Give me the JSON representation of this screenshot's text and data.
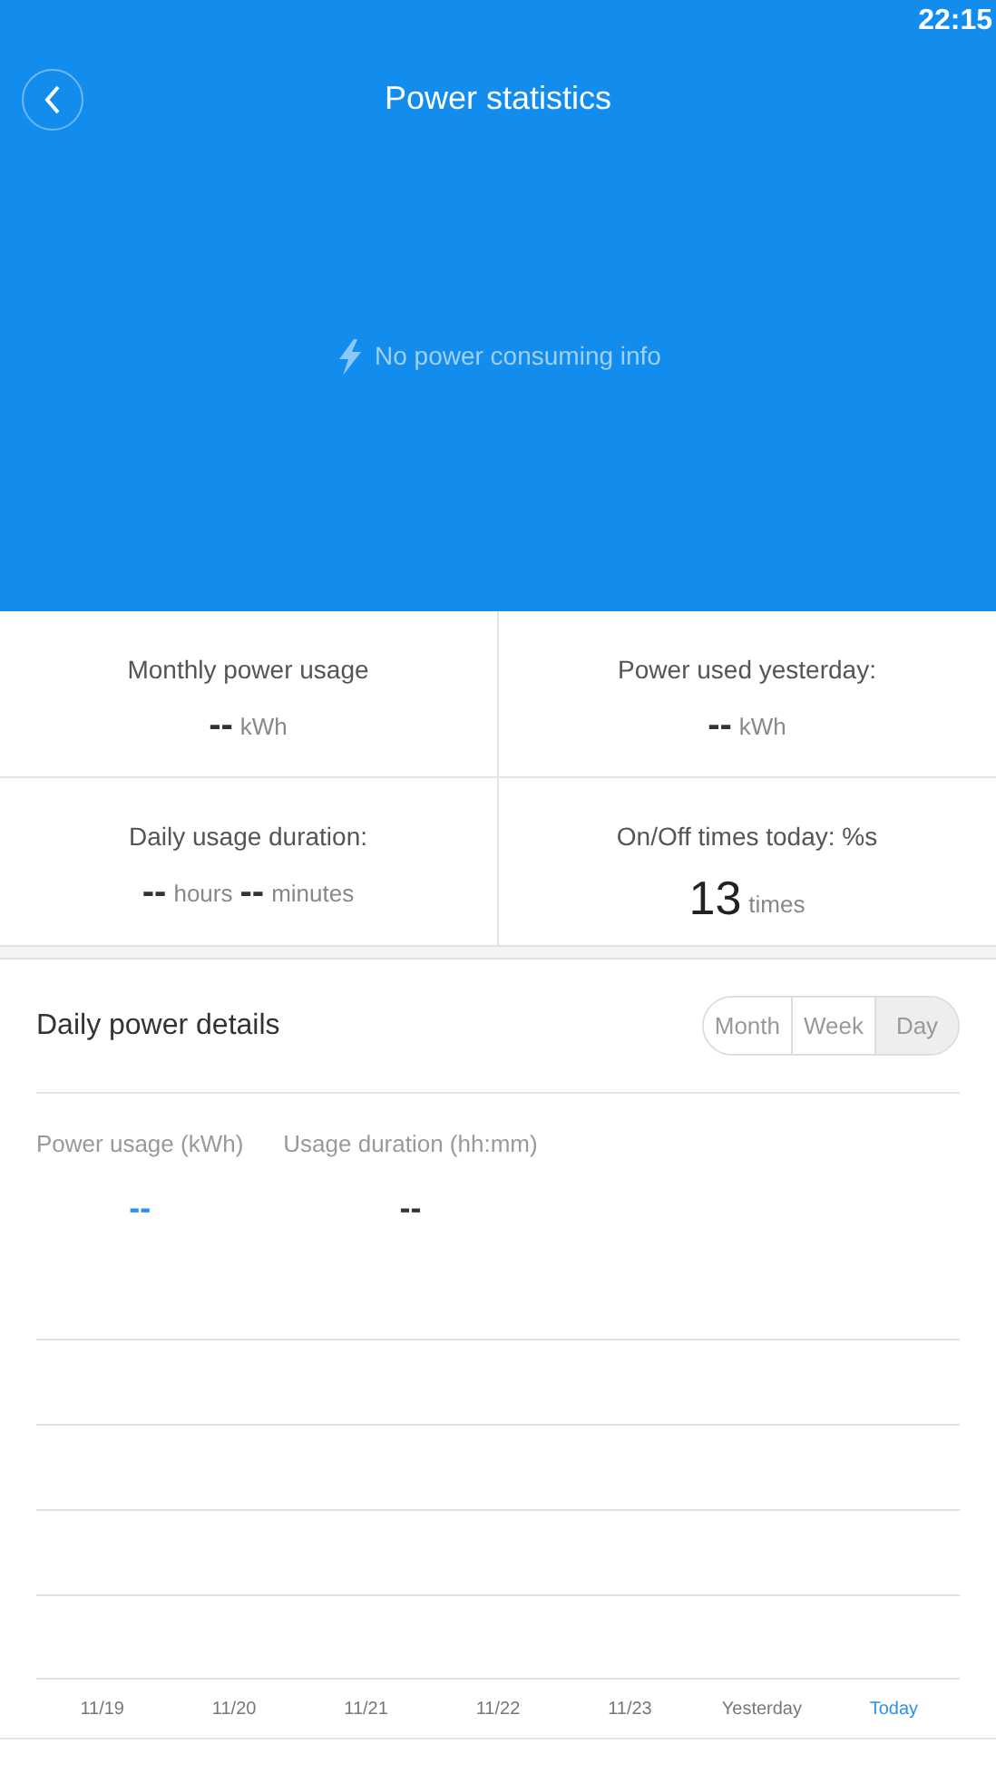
{
  "status_bar": {
    "time": "22:15"
  },
  "header": {
    "title": "Power statistics",
    "empty_message": "No power consuming info"
  },
  "stats": [
    {
      "label": "Monthly power usage",
      "parts": [
        {
          "kind": "number",
          "text": "--"
        },
        {
          "kind": "unit",
          "text": "kWh"
        }
      ]
    },
    {
      "label": "Power used yesterday:",
      "parts": [
        {
          "kind": "number",
          "text": "--"
        },
        {
          "kind": "unit",
          "text": "kWh"
        }
      ]
    },
    {
      "label": "Daily usage duration:",
      "parts": [
        {
          "kind": "number",
          "text": "--"
        },
        {
          "kind": "unit",
          "text": "hours"
        },
        {
          "kind": "number",
          "text": "--"
        },
        {
          "kind": "unit",
          "text": "minutes"
        }
      ]
    },
    {
      "label": "On/Off times today: %s",
      "parts": [
        {
          "kind": "big",
          "text": "13"
        },
        {
          "kind": "unit",
          "text": "times"
        }
      ]
    }
  ],
  "details": {
    "title": "Daily power details",
    "tabs": [
      {
        "label": "Month",
        "selected": false
      },
      {
        "label": "Week",
        "selected": false
      },
      {
        "label": "Day",
        "selected": true
      }
    ],
    "metrics": [
      {
        "label": "Power usage (kWh)",
        "value": "--",
        "selected": true
      },
      {
        "label": "Usage duration (hh:mm)",
        "value": "--",
        "selected": false
      }
    ],
    "dates": [
      {
        "label": "11/19",
        "selected": false
      },
      {
        "label": "11/20",
        "selected": false
      },
      {
        "label": "11/21",
        "selected": false
      },
      {
        "label": "11/22",
        "selected": false
      },
      {
        "label": "11/23",
        "selected": false
      },
      {
        "label": "Yesterday",
        "selected": false
      },
      {
        "label": "Today",
        "selected": true
      }
    ]
  }
}
